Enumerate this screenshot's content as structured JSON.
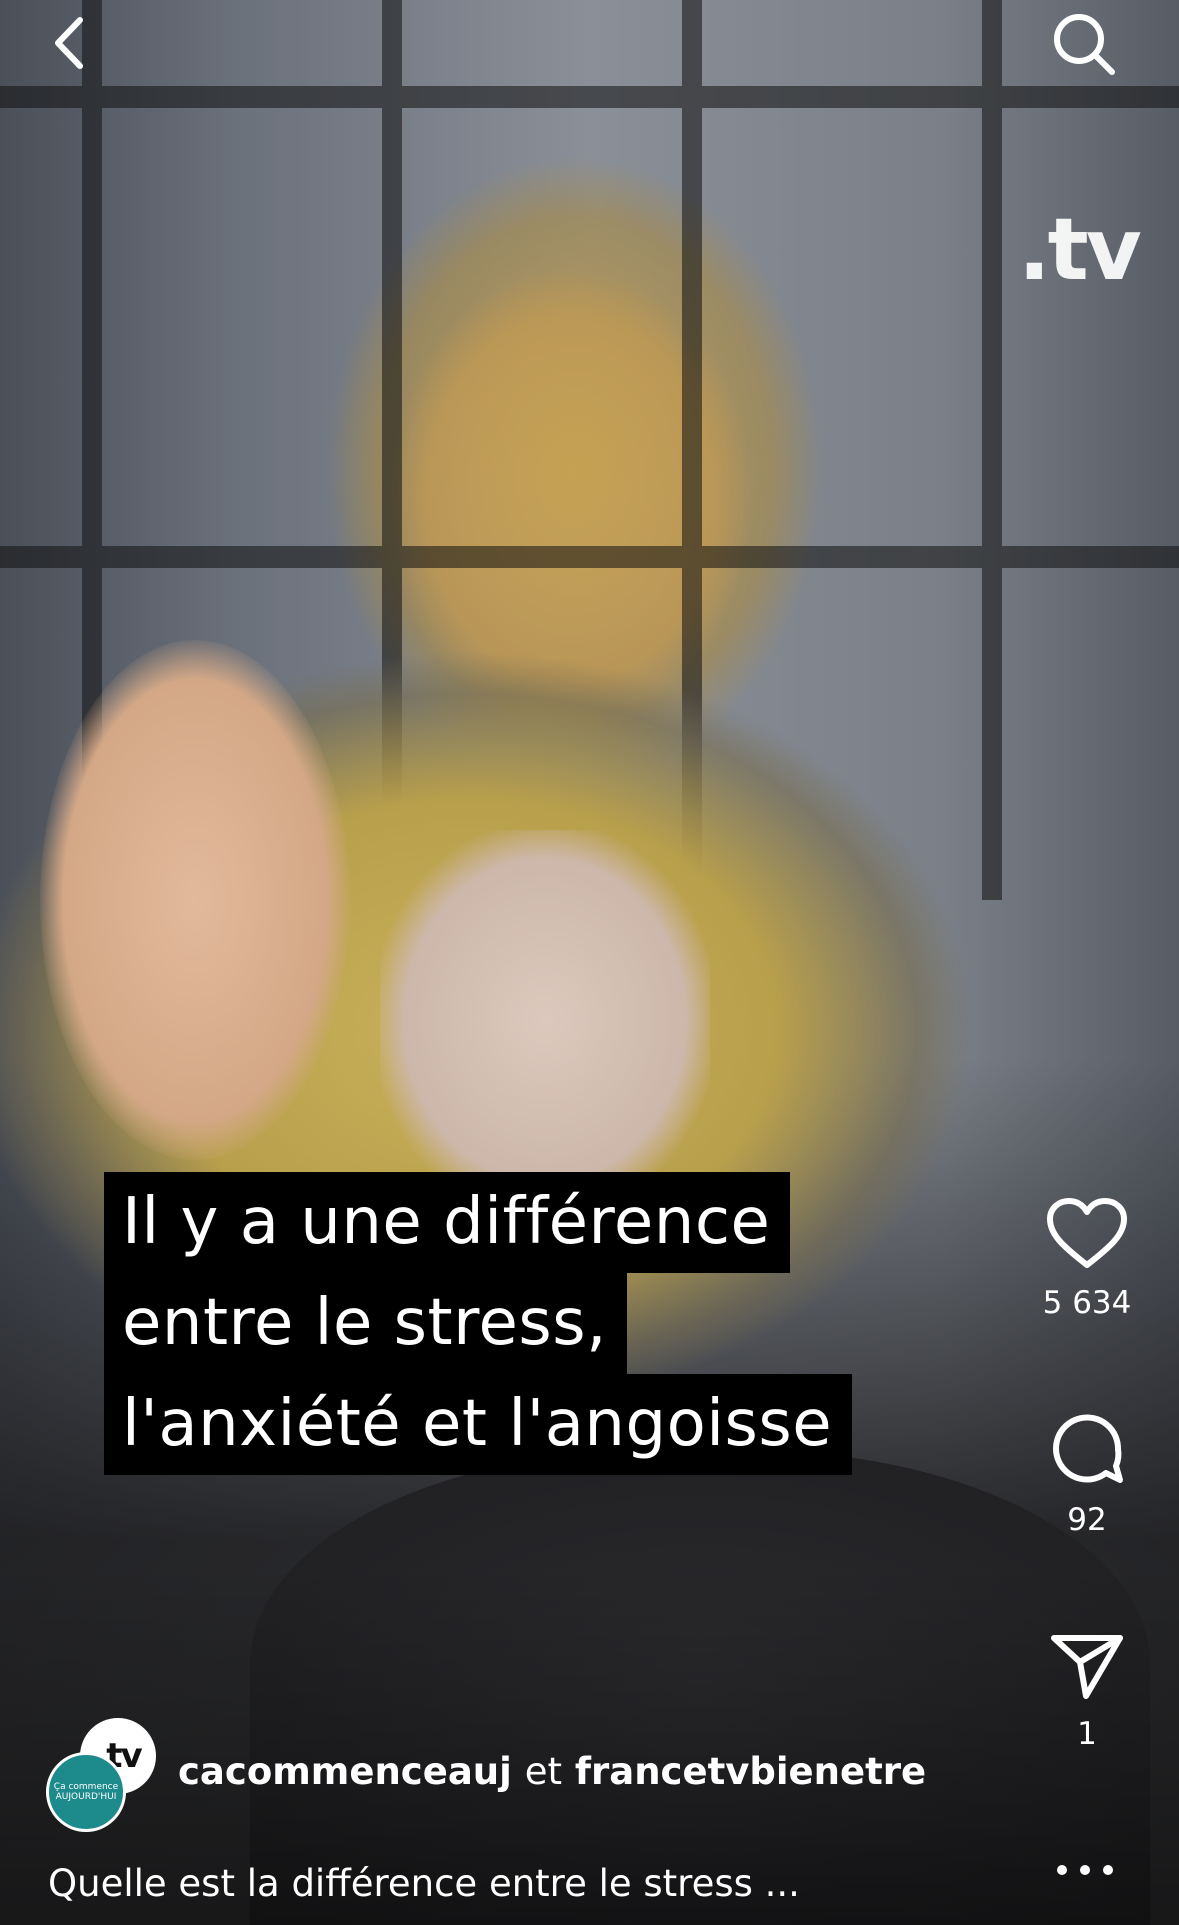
{
  "header": {
    "back_icon": "chevron-left-icon",
    "search_icon": "search-icon"
  },
  "video": {
    "watermark": ".tv",
    "caption_lines": [
      "Il y a une différence",
      "entre le stress,",
      "l'anxiété et l'angoisse"
    ]
  },
  "actions": {
    "like_count": "5 634",
    "comment_count": "92",
    "share_count": "1"
  },
  "footer": {
    "avatar_back_text": ".tv",
    "avatar_front_text": "Ça commence AUJOURD'HUI",
    "author_primary": "cacommenceauj",
    "author_separator": "et",
    "author_secondary": "francetvbienetre",
    "description": "Quelle est la différence entre le stress ..."
  },
  "colors": {
    "caption_bg": "#000000",
    "text": "#ffffff",
    "avatar_teal": "#1d8a8c"
  }
}
